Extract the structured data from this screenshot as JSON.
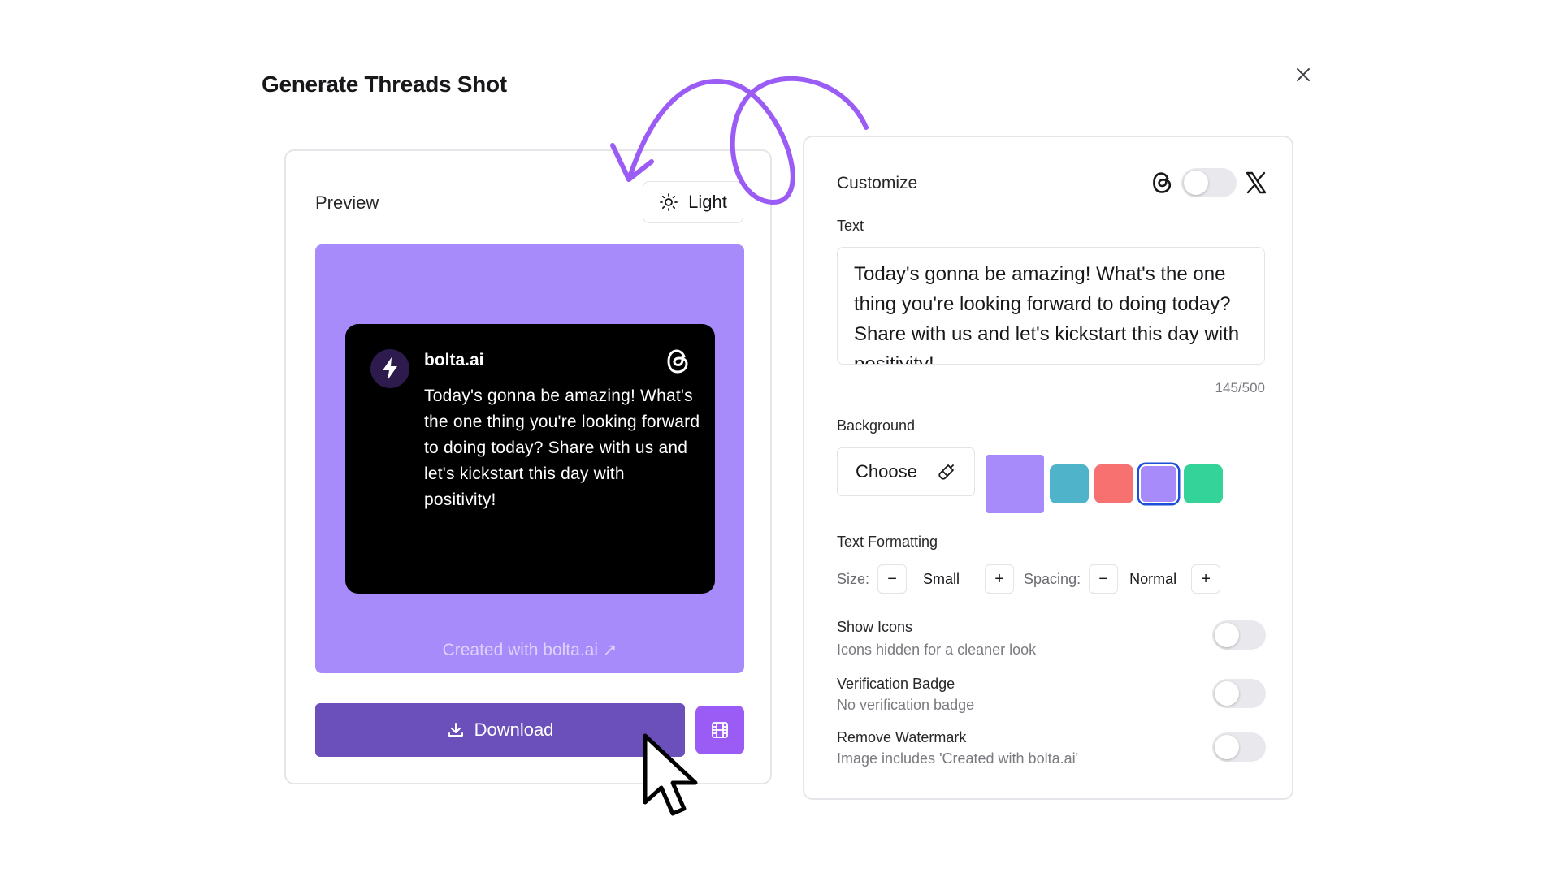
{
  "modal": {
    "title": "Generate Threads Shot"
  },
  "preview": {
    "label": "Preview",
    "theme_label": "Light",
    "post": {
      "username": "bolta.ai",
      "text": "Today's gonna be amazing! What's the one thing you're looking forward to doing today? Share with us and let's kickstart this day with positivity!"
    },
    "watermark": "Created with bolta.ai ↗",
    "background_color": "#a78bfa",
    "download_label": "Download"
  },
  "customize": {
    "title": "Customize",
    "text_label": "Text",
    "text_value": "Today's gonna be amazing! What's the one thing you're looking forward to doing today? Share with us and let's kickstart this day with positivity!",
    "char_count": "145/500",
    "background_label": "Background",
    "choose_label": "Choose",
    "current_bg_color": "#a78bfa",
    "swatches": [
      "#4fb3c9",
      "#f87171",
      "#a78bfa",
      "#34d399"
    ],
    "selected_swatch": 2,
    "text_formatting_label": "Text Formatting",
    "size_label": "Size:",
    "size_value": "Small",
    "spacing_label": "Spacing:",
    "spacing_value": "Normal",
    "decrement_symbol": "−",
    "increment_symbol": "+",
    "options": [
      {
        "title": "Show Icons",
        "subtitle": "Icons hidden for a cleaner look",
        "enabled": false
      },
      {
        "title": "Verification Badge",
        "subtitle": "No verification badge",
        "enabled": false
      },
      {
        "title": "Remove Watermark",
        "subtitle": "Image includes 'Created with bolta.ai'",
        "enabled": false
      }
    ]
  },
  "colors": {
    "accent": "#6b4fbb",
    "video_button": "#9b5cf5",
    "doodle": "#9b5cf5"
  }
}
